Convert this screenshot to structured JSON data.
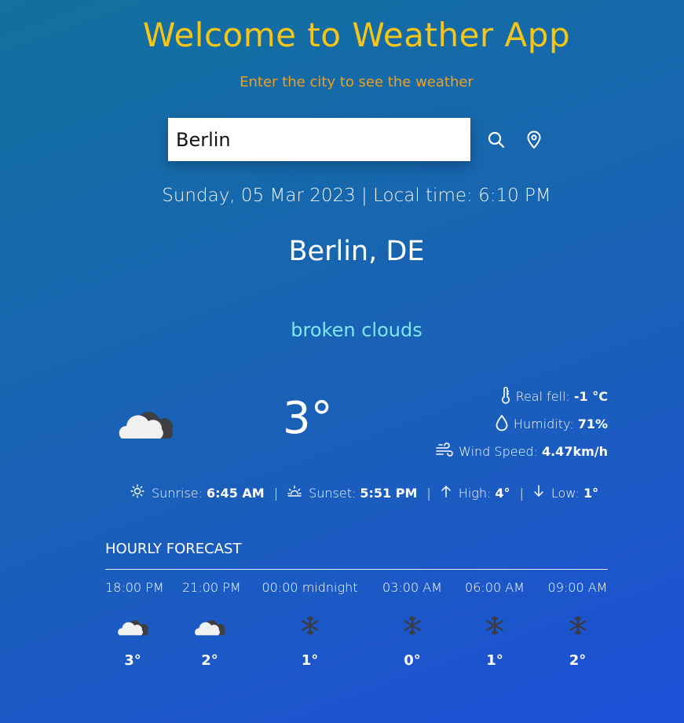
{
  "header": {
    "title": "Welcome to Weather App",
    "subtitle": "Enter the city to see the weather"
  },
  "search": {
    "value": "Berlin",
    "search_icon": "search-icon",
    "location_icon": "location-pin-icon"
  },
  "datetime": "Sunday, 05 Mar 2023 | Local time: 6:10 PM",
  "city": "Berlin, DE",
  "condition": "broken clouds",
  "current": {
    "icon": "broken-clouds-icon",
    "temperature": "3°",
    "real_feel_label": "Real fell:",
    "real_feel_value": "-1 °C",
    "humidity_label": "Humidity:",
    "humidity_value": "71%",
    "wind_label": "Wind Speed:",
    "wind_value": "4.47km/h"
  },
  "sun": {
    "sunrise_label": "Sunrise:",
    "sunrise_value": "6:45 AM",
    "sunset_label": "Sunset:",
    "sunset_value": "5:51 PM",
    "high_label": "High:",
    "high_value": "4°",
    "low_label": "Low:",
    "low_value": "1°",
    "separator": "|"
  },
  "forecast": {
    "title": "HOURLY FORECAST",
    "items": [
      {
        "time": "18:00 PM",
        "icon": "broken-clouds-icon",
        "temp": "3°"
      },
      {
        "time": "21:00 PM",
        "icon": "broken-clouds-icon",
        "temp": "2°"
      },
      {
        "time": "00:00 midnight",
        "icon": "snowflake-icon",
        "temp": "1°"
      },
      {
        "time": "03:00 AM",
        "icon": "snowflake-icon",
        "temp": "0°"
      },
      {
        "time": "06:00 AM",
        "icon": "snowflake-icon",
        "temp": "1°"
      },
      {
        "time": "09:00 AM",
        "icon": "snowflake-icon",
        "temp": "2°"
      }
    ]
  },
  "colors": {
    "title": "#f5c518",
    "subtitle": "#f0a020",
    "condition": "#7fe6f6",
    "background_start": "#12719e",
    "background_end": "#1d4fd8"
  }
}
